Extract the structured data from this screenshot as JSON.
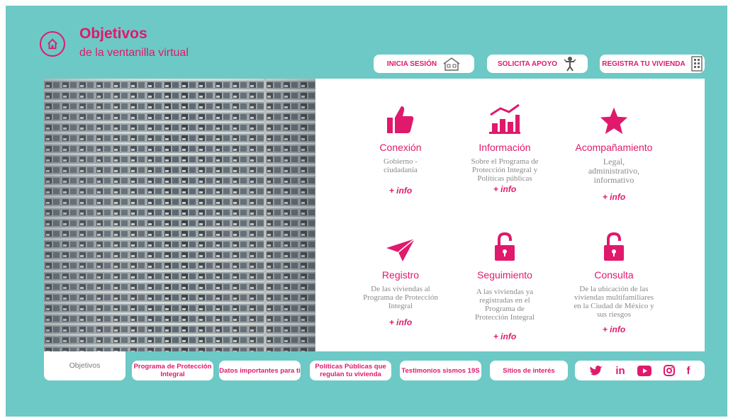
{
  "header": {
    "title": "Objetivos",
    "subtitle": "de la ventanilla virtual",
    "home_icon": "home-icon"
  },
  "top_buttons": [
    {
      "label": "INICIA SESIÓN",
      "icon": "house-icon"
    },
    {
      "label": "SOLICITA APOYO",
      "icon": "person-icon"
    },
    {
      "label": "REGISTRA TU VIVIENDA",
      "icon": "building-icon"
    }
  ],
  "cards": [
    {
      "title": "Conexión",
      "desc": "Gobierno - ciudadanía",
      "more": "+ info",
      "icon": "thumbs-up-icon"
    },
    {
      "title": "Información",
      "desc": "Sobre el Programa de Protección Integral y Políticas públicas",
      "more": "+ info",
      "icon": "bar-chart-icon"
    },
    {
      "title": "Acompañamiento",
      "desc": "Legal, administrativo, informativo",
      "more": "+ info",
      "icon": "star-icon"
    },
    {
      "title": "Registro",
      "desc": "De las viviendas al Programa de Protección Integral",
      "more": "+ info",
      "icon": "paper-plane-icon"
    },
    {
      "title": "Seguimiento",
      "desc": "A las viviendas ya registradas en el Programa de Protección Integral",
      "more": "+ info",
      "icon": "unlock-icon"
    },
    {
      "title": "Consulta",
      "desc": "De la ubicación de las viviendas multifamiliares en la Ciudad de México y sus riesgos",
      "more": "+ info",
      "icon": "unlock-icon"
    }
  ],
  "nav": [
    {
      "label": "Objetivos"
    },
    {
      "label": "Programa de Protección Integral"
    },
    {
      "label": "Datos importantes para ti"
    },
    {
      "label": "Políticas Públicas que regulan tu vivienda"
    },
    {
      "label": "Testimonios sismos 19S"
    },
    {
      "label": "Sitios de interés"
    }
  ],
  "social": [
    {
      "icon": "twitter-icon"
    },
    {
      "label": "in",
      "icon": "linkedin-icon"
    },
    {
      "icon": "youtube-icon"
    },
    {
      "icon": "instagram-icon"
    },
    {
      "label": "f",
      "icon": "facebook-icon"
    }
  ],
  "colors": {
    "background": "#6cc9c6",
    "accent": "#e0196c",
    "panel": "#ffffff",
    "muted_text": "#8a8a8a"
  }
}
